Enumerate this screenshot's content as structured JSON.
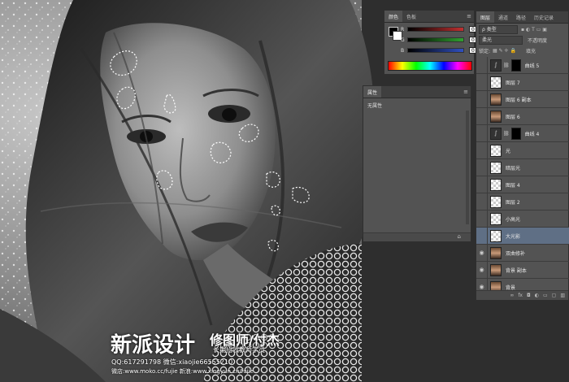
{
  "color_panel": {
    "tabs": [
      "颜色",
      "色板"
    ],
    "channels": [
      {
        "label": "R",
        "value": "0"
      },
      {
        "label": "G",
        "value": "0"
      },
      {
        "label": "B",
        "value": "0"
      }
    ]
  },
  "properties_panel": {
    "tab": "属性",
    "content": "无属性"
  },
  "layers_panel": {
    "tabs": [
      "图层",
      "通道",
      "路径",
      "历史记录"
    ],
    "filter_kind": "ρ 类型",
    "blend_mode": "柔光",
    "opacity_label": "不透明度",
    "lock_label": "锁定:",
    "fill_label": "填充",
    "layers": [
      {
        "name": "曲线 5",
        "thumb": "adjust",
        "mask": true,
        "visible": false,
        "selected": false
      },
      {
        "name": "图层 7",
        "thumb": "transparent",
        "mask": false,
        "visible": false,
        "selected": false
      },
      {
        "name": "图层 6 副本",
        "thumb": "photo",
        "mask": false,
        "visible": false,
        "selected": false
      },
      {
        "name": "图层 6",
        "thumb": "photo",
        "mask": false,
        "visible": false,
        "selected": false
      },
      {
        "name": "曲线 4",
        "thumb": "adjust",
        "mask": true,
        "visible": false,
        "selected": false
      },
      {
        "name": "光",
        "thumb": "transparent",
        "mask": false,
        "visible": false,
        "selected": false
      },
      {
        "name": "暗层光",
        "thumb": "transparent",
        "mask": false,
        "visible": false,
        "selected": false
      },
      {
        "name": "图层 4",
        "thumb": "transparent",
        "mask": false,
        "visible": false,
        "selected": false
      },
      {
        "name": "图层 2",
        "thumb": "transparent",
        "mask": false,
        "visible": false,
        "selected": false
      },
      {
        "name": "小高光",
        "thumb": "transparent",
        "mask": false,
        "visible": false,
        "selected": false
      },
      {
        "name": "大光影",
        "thumb": "transparent",
        "mask": false,
        "visible": false,
        "selected": true
      },
      {
        "name": "双曲修补",
        "thumb": "photo",
        "mask": false,
        "visible": true,
        "selected": false
      },
      {
        "name": "背景 副本",
        "thumb": "photo",
        "mask": false,
        "visible": true,
        "selected": false
      },
      {
        "name": "背景",
        "thumb": "photo",
        "mask": false,
        "visible": true,
        "selected": false
      }
    ],
    "footer_icons": [
      "link-icon",
      "fx-icon",
      "mask-icon",
      "adjustment-icon",
      "folder-icon",
      "new-layer-icon",
      "trash-icon"
    ]
  },
  "watermark": {
    "brand": "新派设计",
    "subtitle": "修图师/付杰",
    "tagline": "长期招收教师学员",
    "contact_line1": "QQ:617291798  微信:xiaojie66555210",
    "contact_line2": "微店:www.moko.cc/fujie  新浪:www.xingyun.cn/fujie"
  },
  "colors": {
    "panel_bg": "#535353",
    "tab_bg": "#3f3f3f",
    "selected_layer": "#5f6f85",
    "slider_r": "#c03030",
    "slider_g": "#30a030",
    "slider_b": "#3050c0"
  }
}
